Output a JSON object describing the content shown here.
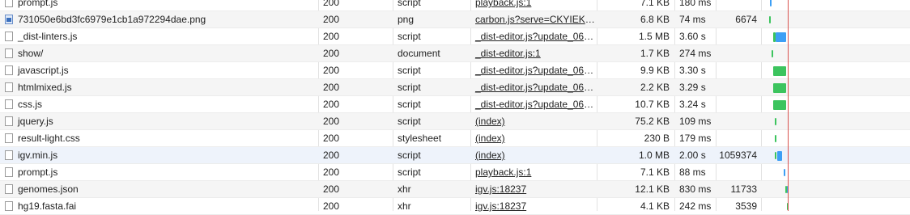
{
  "rows": [
    {
      "name": "prompt.js",
      "status": "200",
      "type": "script",
      "initiator": "playback.js:1",
      "size": "7.1 KB",
      "time": "180 ms",
      "extra": "",
      "icon": "file-icon"
    },
    {
      "name": "731050e6bd3fc6979e1cb1a972294dae.png",
      "status": "200",
      "type": "png",
      "initiator": "carbon.js?serve=CKYIEKQ...",
      "size": "6.8 KB",
      "time": "74 ms",
      "extra": "6674",
      "icon": "image-icon"
    },
    {
      "name": "_dist-linters.js",
      "status": "200",
      "type": "script",
      "initiator": "_dist-editor.js?update_06_...",
      "size": "1.5 MB",
      "time": "3.60 s",
      "extra": "",
      "icon": "file-icon"
    },
    {
      "name": "show/",
      "status": "200",
      "type": "document",
      "initiator": "_dist-editor.js:1",
      "size": "1.7 KB",
      "time": "274 ms",
      "extra": "",
      "icon": "file-icon"
    },
    {
      "name": "javascript.js",
      "status": "200",
      "type": "script",
      "initiator": "_dist-editor.js?update_06_...",
      "size": "9.9 KB",
      "time": "3.30 s",
      "extra": "",
      "icon": "file-icon"
    },
    {
      "name": "htmlmixed.js",
      "status": "200",
      "type": "script",
      "initiator": "_dist-editor.js?update_06_...",
      "size": "2.2 KB",
      "time": "3.29 s",
      "extra": "",
      "icon": "file-icon"
    },
    {
      "name": "css.js",
      "status": "200",
      "type": "script",
      "initiator": "_dist-editor.js?update_06_...",
      "size": "10.7 KB",
      "time": "3.24 s",
      "extra": "",
      "icon": "file-icon"
    },
    {
      "name": "jquery.js",
      "status": "200",
      "type": "script",
      "initiator": "(index)",
      "size": "75.2 KB",
      "time": "109 ms",
      "extra": "",
      "icon": "file-icon"
    },
    {
      "name": "result-light.css",
      "status": "200",
      "type": "stylesheet",
      "initiator": "(index)",
      "size": "230 B",
      "time": "179 ms",
      "extra": "",
      "icon": "file-icon"
    },
    {
      "name": "igv.min.js",
      "status": "200",
      "type": "script",
      "initiator": "(index)",
      "size": "1.0 MB",
      "time": "2.00 s",
      "extra": "1059374",
      "icon": "file-icon"
    },
    {
      "name": "prompt.js",
      "status": "200",
      "type": "script",
      "initiator": "playback.js:1",
      "size": "7.1 KB",
      "time": "88 ms",
      "extra": "",
      "icon": "file-icon"
    },
    {
      "name": "genomes.json",
      "status": "200",
      "type": "xhr",
      "initiator": "igv.js:18237",
      "size": "12.1 KB",
      "time": "830 ms",
      "extra": "11733",
      "icon": "file-icon"
    },
    {
      "name": "hg19.fasta.fai",
      "status": "200",
      "type": "xhr",
      "initiator": "igv.js:18237",
      "size": "4.1 KB",
      "time": "242 ms",
      "extra": "3539",
      "icon": "file-icon"
    }
  ],
  "colors": {
    "waiting": "#3cc45e",
    "download": "#3d9ff5",
    "load_line": "#d9534f"
  }
}
